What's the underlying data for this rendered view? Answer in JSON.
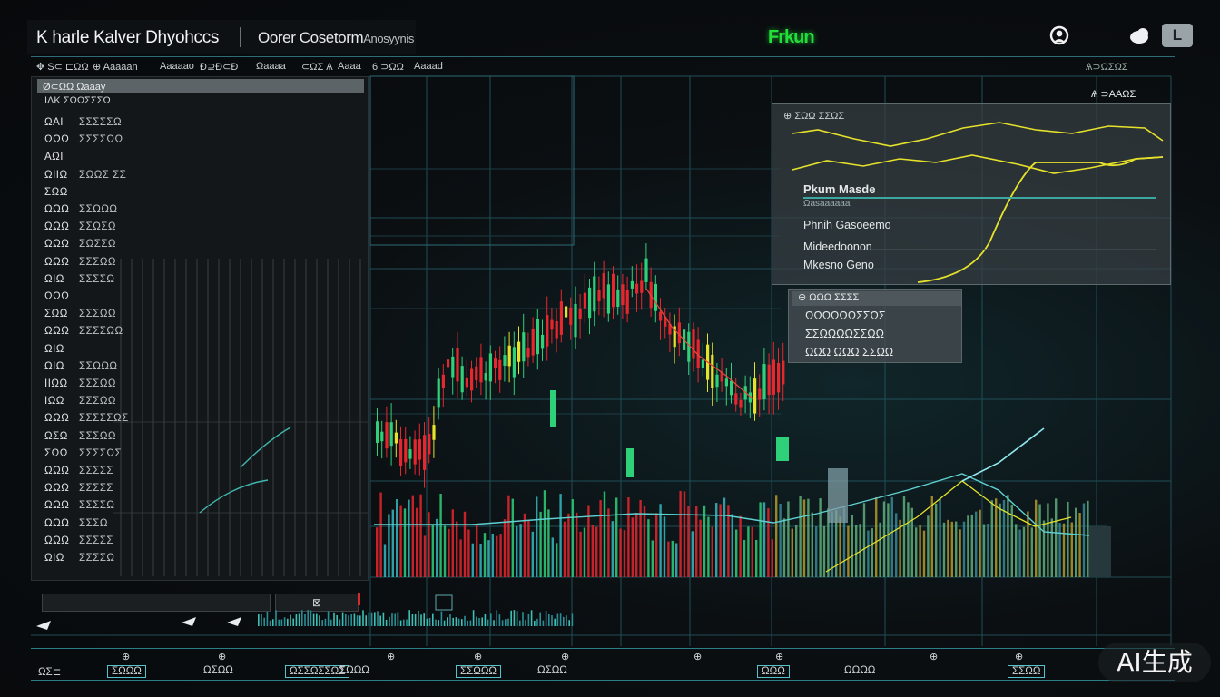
{
  "header": {
    "app_title": "K harle Kalver Dhyohccs",
    "subtitle": "Oorer Cosetorm",
    "subtitle_small": "Anosyynis",
    "brand": "Frkun",
    "lang_badge": "L"
  },
  "menubar": {
    "items": [
      "✥ S⊂ ⊏ΩΩ",
      "⊕ Aaaaan",
      "Aaaaao",
      "Ð⊇Ð⊂Ð",
      "Ωaaaa",
      "⊂ΩΣ Ѧ",
      "Aaaa",
      "6 ⊃ΩΩ",
      "Aaaad"
    ],
    "right_label": "Ѧ⊃ΩΣΩΣ",
    "right_sub": "Ѧ ⊃ΑΑΩΣ"
  },
  "left_panel": {
    "header": "Ø⊂ΩΩ    Ωaaay",
    "header2": "ΙΛΚ  ΣΩΩΣΣΣΩ",
    "rows": [
      {
        "k": "ΩΑΙ",
        "v": "ΣΣΣΣΣΩ"
      },
      {
        "k": "ΩΩΩ",
        "v": "ΣΣΣΣΩΩ"
      },
      {
        "k": "ΑΩΙ",
        "v": ""
      },
      {
        "k": "ΩΙΙΩ",
        "v": "ΣΩΩΣ ΣΣ"
      },
      {
        "k": "ΣΩΩ",
        "v": ""
      },
      {
        "k": "ΩΩΩ",
        "v": "ΣΣΩΩΩ"
      },
      {
        "k": "ΩΩΩ",
        "v": "ΣΣΩΣΩ"
      },
      {
        "k": "ΩΩΩ",
        "v": "ΣΩΣΣΩ"
      },
      {
        "k": "ΩΩΩ",
        "v": "ΣΣΣΩΩ"
      },
      {
        "k": "ΩΙΩ",
        "v": "ΣΣΣΣΩ"
      },
      {
        "k": "ΩΩΩ",
        "v": ""
      },
      {
        "k": "ΣΩΩ",
        "v": "ΣΣΣΩΩ"
      },
      {
        "k": "ΩΩΩ",
        "v": "ΣΣΣΣΩΩ"
      },
      {
        "k": "ΩΙΩ",
        "v": ""
      },
      {
        "k": "ΩΙΩ",
        "v": "ΣΣΩΩΩ"
      },
      {
        "k": "ΙΙΩΩ",
        "v": "ΣΣΣΩΩ"
      },
      {
        "k": "ΙΩΩ",
        "v": "ΣΣΣΩΩ"
      },
      {
        "k": "ΩΩΩ",
        "v": "ΣΣΣΣΣΩΣ"
      },
      {
        "k": "ΩΣΩ",
        "v": "ΣΣΣΩΩ"
      },
      {
        "k": "ΣΩΩ",
        "v": "ΣΣΣΣΩΣ"
      },
      {
        "k": "ΩΩΩ",
        "v": "ΣΣΣΣΣ"
      },
      {
        "k": "ΩΩΩ",
        "v": "ΣΣΣΣΣ"
      },
      {
        "k": "ΩΩΩ",
        "v": "ΣΣΣΣΩ"
      },
      {
        "k": "ΩΩΩ",
        "v": "ΣΣΣΩ"
      },
      {
        "k": "ΩΩΩ",
        "v": "ΣΣΣΣΣ"
      },
      {
        "k": "ΩΙΩ",
        "v": "ΣΣΣΣΩ"
      }
    ],
    "footer_button": "⊠"
  },
  "popup_main": {
    "header": "⊕ ΣΩΩ ΣΣΩΣ",
    "lines": [
      "Pkum Masde",
      "Ωasaaaaaa",
      "Phnih Gasoeemo",
      "Mideedoonon",
      "Mkesno Geno"
    ],
    "series_colors": [
      "#e6e22a",
      "#e6e22a"
    ]
  },
  "popup_sub": {
    "header": "⊕ ΩΩΩ ΣΣΣΣ",
    "lines": [
      "ΩΩΩΩΩΩΣΣΩΣ",
      "ΣΣΩΩΩΩΣΣΩΩ",
      "ΩΩΩ ΩΩΩ ΣΣΩΩ"
    ]
  },
  "bottom": {
    "icons": [
      "⊕",
      "⊕",
      "⊕",
      "⊕",
      "⊕",
      "⊕",
      "⊕",
      "⊕",
      "⊕"
    ],
    "labels": [
      "ΩΣ⊏",
      "ΣΩΩΩ",
      "ΩΣΩΩ",
      "ΩΣΣΩΣΣΩΣ",
      "ΣΩΩΩ",
      "ΣΣΩΩΩ",
      "ΩΣΩΩ",
      "ΩΩΩ",
      "ΩΩΩΩ",
      "ΣΣΩΩ"
    ]
  },
  "watermark": "AI生成",
  "colors": {
    "up": "#2fd07a",
    "down": "#e8262e",
    "accent": "#36b8c0",
    "neutral": "#e6e22a"
  }
}
